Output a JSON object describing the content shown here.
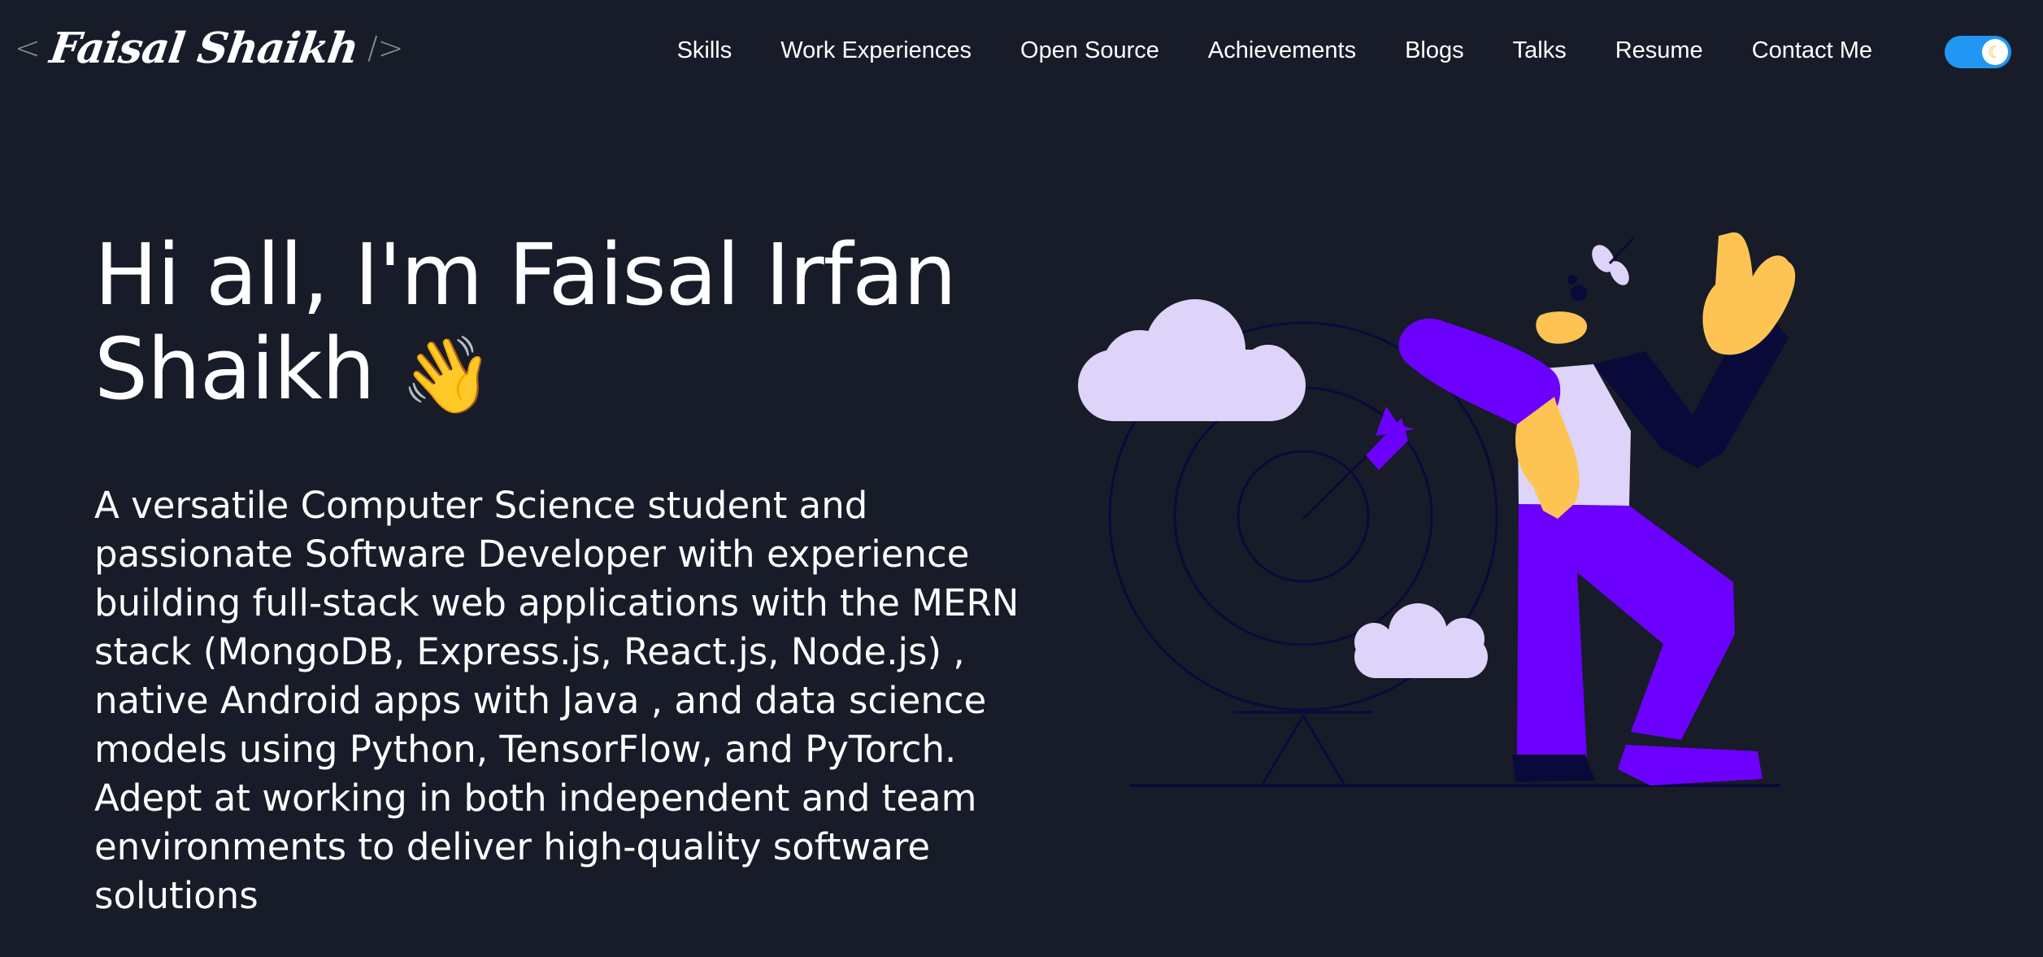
{
  "header": {
    "logo": {
      "open_bracket": "<",
      "name": "Faisal Shaikh",
      "close_bracket": "/>"
    },
    "nav": [
      {
        "label": "Skills"
      },
      {
        "label": "Work Experiences"
      },
      {
        "label": "Open Source"
      },
      {
        "label": "Achievements"
      },
      {
        "label": "Blogs"
      },
      {
        "label": "Talks"
      },
      {
        "label": "Resume"
      },
      {
        "label": "Contact Me"
      }
    ],
    "theme_toggle": {
      "icon": "moon-icon",
      "state": "on",
      "color": "#2196f3",
      "glyph": "☾"
    }
  },
  "hero": {
    "title": "Hi all, I'm Faisal Irfan Shaikh",
    "wave_emoji": "👋",
    "subtitle": "A versatile Computer Science student and passionate Software Developer with experience building full-stack web applications with the MERN stack (MongoDB, Express.js, React.js, Node.js) , native Android apps with Java , and data science models using Python, TensorFlow, and PyTorch. Adept at working in both independent and team environments to deliver high-quality software solutions"
  },
  "colors": {
    "background": "#171c28",
    "accent_purple": "#6c00ff",
    "accent_yellow": "#fdc453",
    "cloud": "#ded3f8",
    "toggle": "#2196f3"
  }
}
